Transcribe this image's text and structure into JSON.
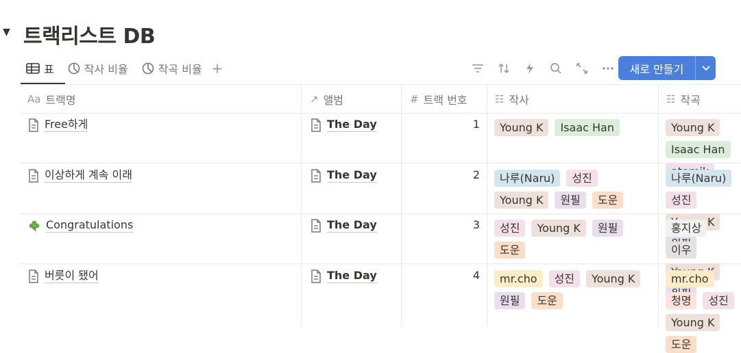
{
  "page": {
    "title": "트랙리스트 DB"
  },
  "views": [
    {
      "label": "표",
      "icon": "table-icon"
    },
    {
      "label": "작사 비율",
      "icon": "pie-chart-icon"
    },
    {
      "label": "작곡 비율",
      "icon": "pie-chart-icon"
    }
  ],
  "toolbar": {
    "add_view": "+",
    "new_button_label": "새로 만들기"
  },
  "columns": [
    {
      "label": "트랙명",
      "icon_text": "Aa"
    },
    {
      "label": "앨범",
      "icon_text": "↗"
    },
    {
      "label": "트랙 번호",
      "icon_text": "#"
    },
    {
      "label": "작사",
      "icon_text": "☷"
    },
    {
      "label": "작곡",
      "icon_text": "☷"
    }
  ],
  "rows": [
    {
      "name": "Free하게",
      "name_icon": "page-icon",
      "album": "The Day",
      "track_no": "1",
      "lyrics": [
        {
          "t": "Young K",
          "c": "brown"
        },
        {
          "t": "Isaac Han",
          "c": "green"
        }
      ],
      "composer": [
        {
          "t": "Young K",
          "c": "brown"
        },
        {
          "t": "Isaac Han",
          "c": "green"
        },
        {
          "t": "atomik",
          "c": "pink"
        }
      ]
    },
    {
      "name": "이상하게 계속 이래",
      "name_icon": "page-icon",
      "album": "The Day",
      "track_no": "2",
      "lyrics": [
        {
          "t": "나루(Naru)",
          "c": "blue"
        },
        {
          "t": "성진",
          "c": "pink"
        },
        {
          "t": "Young K",
          "c": "brown"
        },
        {
          "t": "원필",
          "c": "purple"
        },
        {
          "t": "도운",
          "c": "orange"
        }
      ],
      "composer": [
        {
          "t": "나루(Naru)",
          "c": "blue"
        },
        {
          "t": "성진",
          "c": "pink"
        },
        {
          "t": "Young K",
          "c": "brown"
        },
        {
          "t": "원필",
          "c": "purple"
        }
      ]
    },
    {
      "name": "Congratulations",
      "name_icon": "clover-icon",
      "album": "The Day",
      "track_no": "3",
      "lyrics": [
        {
          "t": "성진",
          "c": "pink"
        },
        {
          "t": "Young K",
          "c": "brown"
        },
        {
          "t": "원필",
          "c": "purple"
        },
        {
          "t": "도운",
          "c": "orange"
        }
      ],
      "composer": [
        {
          "t": "홍지상",
          "c": "light"
        },
        {
          "t": "이우",
          "c": "gray"
        },
        {
          "t": "Young K",
          "c": "brown"
        },
        {
          "t": "원필",
          "c": "purple"
        }
      ]
    },
    {
      "name": "버릇이 됐어",
      "name_icon": "page-icon",
      "album": "The Day",
      "track_no": "4",
      "lyrics": [
        {
          "t": "mr.cho",
          "c": "yellow"
        },
        {
          "t": "성진",
          "c": "pink"
        },
        {
          "t": "Young K",
          "c": "brown"
        },
        {
          "t": "원필",
          "c": "purple"
        },
        {
          "t": "도운",
          "c": "orange"
        }
      ],
      "composer": [
        {
          "t": "mr.cho",
          "c": "yellow"
        },
        {
          "t": "청명",
          "c": "red"
        },
        {
          "t": "성진",
          "c": "pink"
        },
        {
          "t": "Young K",
          "c": "brown"
        },
        {
          "t": "도운",
          "c": "orange"
        }
      ]
    }
  ]
}
